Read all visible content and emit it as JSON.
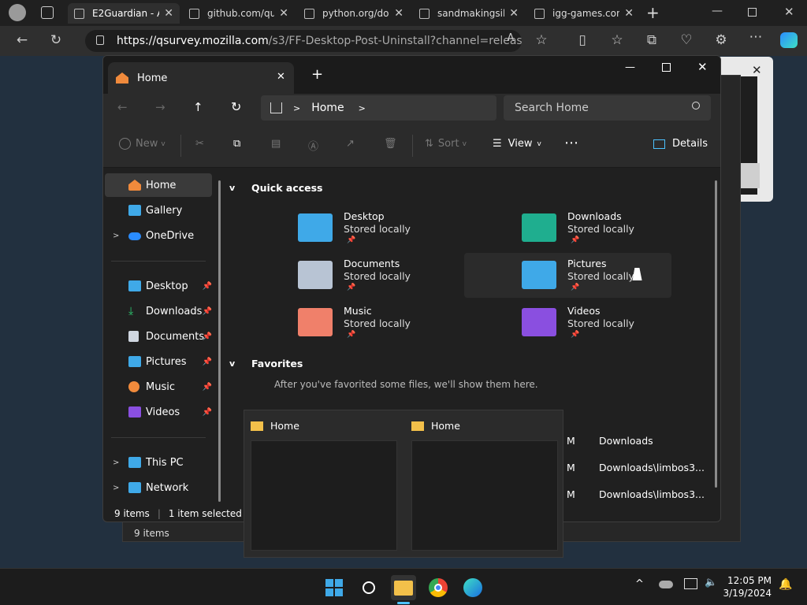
{
  "browser": {
    "tabs": [
      {
        "title": "E2Guardian - A",
        "active": true
      },
      {
        "title": "github.com/qu"
      },
      {
        "title": "python.org/do"
      },
      {
        "title": "sandmakingsil"
      },
      {
        "title": "igg-games.con"
      }
    ],
    "url_host": "https://qsurvey.mozilla.com",
    "url_path": "/s3/FF-Desktop-Post-Uninstall?channel=release..."
  },
  "explorer": {
    "tab_title": "Home",
    "breadcrumb": "Home",
    "search_placeholder": "Search Home",
    "commands": {
      "new": "New",
      "sort": "Sort",
      "view": "View",
      "details": "Details"
    },
    "sidebar": {
      "home": "Home",
      "gallery": "Gallery",
      "onedrive": "OneDrive",
      "desktop": "Desktop",
      "downloads": "Downloads",
      "documents": "Documents",
      "pictures": "Pictures",
      "music": "Music",
      "videos": "Videos",
      "thispc": "This PC",
      "network": "Network"
    },
    "quick_access_title": "Quick access",
    "quick_access": [
      {
        "name": "Desktop",
        "status": "Stored locally"
      },
      {
        "name": "Downloads",
        "status": "Stored locally"
      },
      {
        "name": "Documents",
        "status": "Stored locally"
      },
      {
        "name": "Pictures",
        "status": "Stored locally"
      },
      {
        "name": "Music",
        "status": "Stored locally"
      },
      {
        "name": "Videos",
        "status": "Stored locally"
      }
    ],
    "favorites_title": "Favorites",
    "favorites_empty": "After you've favorited some files, we'll show them here.",
    "recent_partial": [
      {
        "time": "M",
        "location": "Downloads"
      },
      {
        "time": "M",
        "location": "Downloads\\limbos3..."
      },
      {
        "time": "M",
        "location": "Downloads\\limbos3..."
      }
    ],
    "status": {
      "items": "9 items",
      "selected": "1 item selected"
    },
    "bg_status_items": "9 items"
  },
  "thumbnails": [
    {
      "title": "Home"
    },
    {
      "title": "Home"
    }
  ],
  "taskbar": {
    "time": "12:05 PM",
    "date": "3/19/2024"
  },
  "colors": {
    "accent": "#4cc2ff",
    "folder": "#f3c04a"
  }
}
